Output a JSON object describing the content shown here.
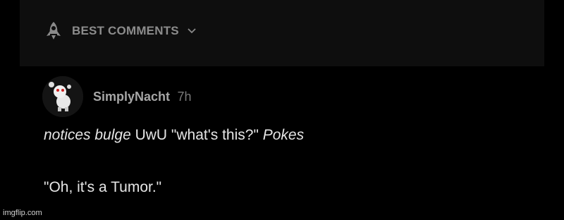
{
  "sort_bar": {
    "label": "BEST COMMENTS",
    "icon": "rocket-icon",
    "dropdown_icon": "chevron-down-icon"
  },
  "comment": {
    "author": "SimplyNacht",
    "time": "7h",
    "avatar_icon": "avatar",
    "body": {
      "line1_action1": "notices bulge",
      "line1_text1": " UwU \"what's this?\" ",
      "line1_action2": "Pokes",
      "line2": "\"Oh, it's a Tumor.\""
    }
  },
  "watermark": "imgflip.com",
  "colors": {
    "background": "#000000",
    "bar": "#0e0e0e",
    "muted_text": "#8c8c8c",
    "body_text": "#e6e6e6"
  }
}
